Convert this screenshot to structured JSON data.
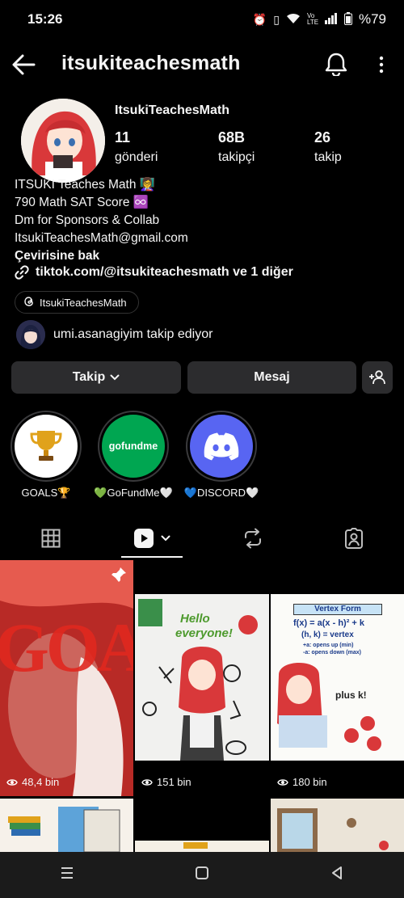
{
  "status_bar": {
    "time": "15:26",
    "battery_label": "%79",
    "network_label": "Vo LTE"
  },
  "header": {
    "username": "itsukiteachesmath"
  },
  "profile": {
    "display_name": "ItsukiTeachesMath",
    "stats": [
      {
        "value": "11",
        "label": "gönderi"
      },
      {
        "value": "68B",
        "label": "takipçi"
      },
      {
        "value": "26",
        "label": "takip"
      }
    ],
    "bio_lines": [
      "ITSUKI Teaches Math 👩‍🏫",
      "790 Math SAT Score ♾️",
      "Dm for Sponsors & Collab",
      "ItsukiTeachesMath@gmail.com"
    ],
    "translate_label": "Çevirisine bak",
    "link_text": "tiktok.com/@itsukiteachesmath ve 1 diğer",
    "threads_label": "ItsukiTeachesMath",
    "mutual_follow_text": "umi.asanagiyim takip ediyor"
  },
  "actions": {
    "follow_label": "Takip",
    "message_label": "Mesaj"
  },
  "highlights": [
    {
      "label": "GOALS🏆",
      "icon": "trophy-icon"
    },
    {
      "label": "💚GoFundMe🤍",
      "icon": "gofundme-logo",
      "logo_text": "gofundme"
    },
    {
      "label": "💙DISCORD🤍",
      "icon": "discord-logo"
    }
  ],
  "tabs": [
    {
      "icon": "grid-icon"
    },
    {
      "icon": "reels-icon"
    },
    {
      "icon": "repost-icon"
    },
    {
      "icon": "tagged-icon"
    }
  ],
  "posts": [
    {
      "views": "48,4 bin",
      "pinned": true,
      "overlay_text": "GOAL"
    },
    {
      "views": "151 bin",
      "overlay_text_1": "Hello",
      "overlay_text_2": "everyone!"
    },
    {
      "views": "180 bin",
      "title": "Vertex Form",
      "line1": "f(x) = a(x - h)² + k",
      "line2": "(h, k) = vertex",
      "line3": "+a: opens up (min)",
      "line4": "-a: opens down (max)",
      "caption": "plus k!"
    }
  ],
  "colors": {
    "background": "#000000",
    "button": "#2c2c2e",
    "gofundme_green": "#00a651",
    "discord_blurple": "#5865f2"
  }
}
